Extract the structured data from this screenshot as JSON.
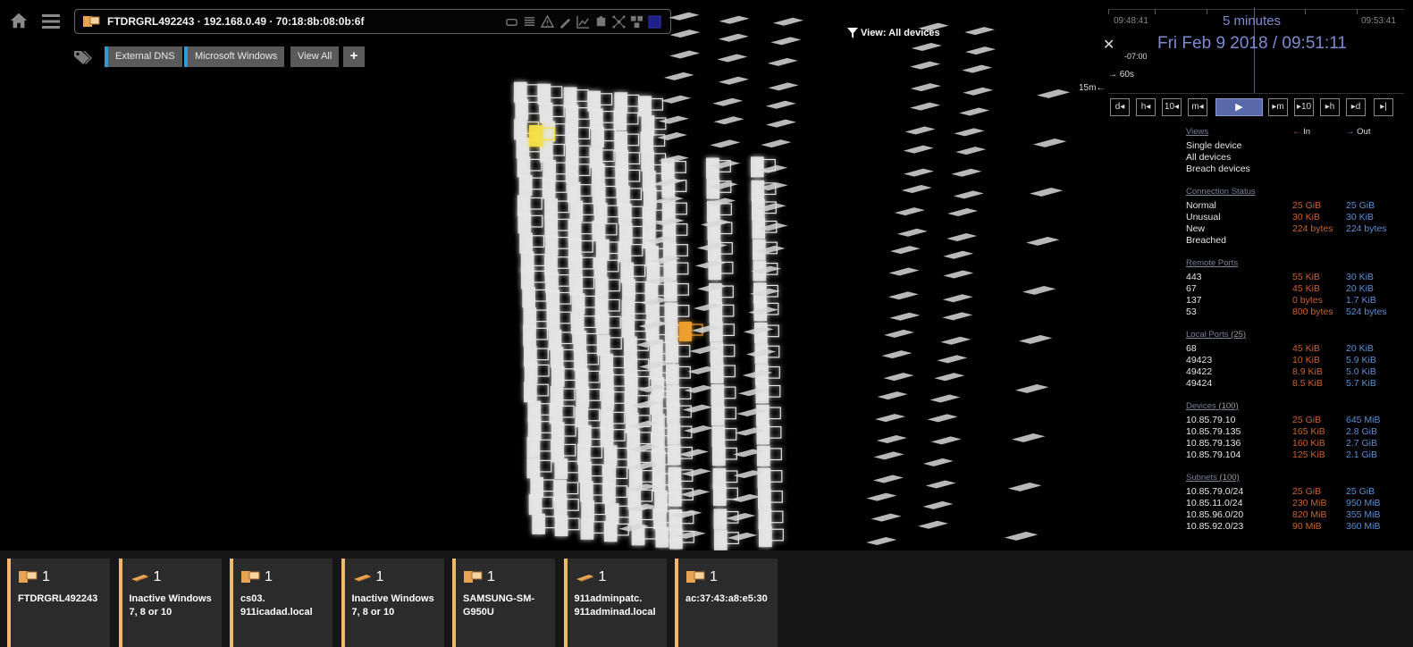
{
  "device": {
    "title": "FTDRGRL492243 · 192.168.0.49 · 70:18:8b:08:0b:6f",
    "tags": [
      "External DNS",
      "Microsoft Windows",
      "View All"
    ],
    "add_tag": "+"
  },
  "view": {
    "label": "View: All devices"
  },
  "timeline": {
    "start": "09:48:41",
    "end": "09:53:41",
    "duration": "5 minutes",
    "datetime": "Fri Feb 9 2018 / 09:51:11",
    "close": "✕",
    "offset": "-07:00",
    "step_label": "60s",
    "range_label": "15m",
    "buttons_back": [
      "d",
      "h",
      "10",
      "m"
    ],
    "buttons_fwd": [
      "m",
      "10",
      "h",
      "d"
    ]
  },
  "stats": {
    "views": {
      "title": "Views",
      "items": [
        "Single device",
        "All devices",
        "Breach devices"
      ],
      "in_label": "In",
      "out_label": "Out"
    },
    "connection_status": {
      "title": "Connection Status",
      "rows": [
        {
          "k": "Normal",
          "in": "25 GiB",
          "out": "25 GiB"
        },
        {
          "k": "Unusual",
          "in": "30 KiB",
          "out": "30 KiB"
        },
        {
          "k": "New",
          "in": "224 bytes",
          "out": "224 bytes"
        },
        {
          "k": "Breached",
          "in": "",
          "out": ""
        }
      ]
    },
    "remote_ports": {
      "title": "Remote Ports",
      "rows": [
        {
          "k": "443",
          "in": "55 KiB",
          "out": "30 KiB"
        },
        {
          "k": "67",
          "in": "45 KiB",
          "out": "20 KiB"
        },
        {
          "k": "137",
          "in": "0 bytes",
          "out": "1.7 KiB"
        },
        {
          "k": "53",
          "in": "800 bytes",
          "out": "524 bytes"
        }
      ]
    },
    "local_ports": {
      "title": "Local Ports",
      "count": "(25)",
      "rows": [
        {
          "k": "68",
          "in": "45 KiB",
          "out": "20 KiB"
        },
        {
          "k": "49423",
          "in": "10 KiB",
          "out": "5.9 KiB"
        },
        {
          "k": "49422",
          "in": "8.9 KiB",
          "out": "5.0 KiB"
        },
        {
          "k": "49424",
          "in": "8.5 KiB",
          "out": "5.7 KiB"
        }
      ]
    },
    "devices": {
      "title": "Devices",
      "count": "(100)",
      "rows": [
        {
          "k": "10.85.79.10",
          "in": "25 GiB",
          "out": "645 MiB"
        },
        {
          "k": "10.85.79.135",
          "in": "165 KiB",
          "out": "2.8 GiB"
        },
        {
          "k": "10.85.79.136",
          "in": "160 KiB",
          "out": "2.7 GiB"
        },
        {
          "k": "10.85.79.104",
          "in": "125 KiB",
          "out": "2.1 GiB"
        }
      ]
    },
    "subnets": {
      "title": "Subnets",
      "count": "(100)",
      "rows": [
        {
          "k": "10.85.79.0/24",
          "in": "25 GiB",
          "out": "25 GiB"
        },
        {
          "k": "10.85.11.0/24",
          "in": "230 MiB",
          "out": "950 MiB"
        },
        {
          "k": "10.85.96.0/20",
          "in": "820 MiB",
          "out": "355 MiB"
        },
        {
          "k": "10.85.92.0/23",
          "in": "90 MiB",
          "out": "360 MiB"
        }
      ]
    }
  },
  "cards": [
    {
      "count": "1",
      "name": "FTDRGRL492243",
      "icon": "desktop-icon"
    },
    {
      "count": "1",
      "name": "Inactive Windows 7, 8 or 10",
      "icon": "laptop-icon"
    },
    {
      "count": "1",
      "name": "cs03. 911icadad.local",
      "icon": "desktop-icon"
    },
    {
      "count": "1",
      "name": "Inactive Windows 7, 8 or 10",
      "icon": "laptop-icon"
    },
    {
      "count": "1",
      "name": "SAMSUNG-SM-G950U",
      "icon": "desktop-icon"
    },
    {
      "count": "1",
      "name": "911adminpatc. 911adminad.local",
      "icon": "laptop-icon"
    },
    {
      "count": "1",
      "name": "ac:37:43:a8:e5:30",
      "icon": "desktop-icon"
    }
  ],
  "colors": {
    "accent_orange": "#f0b86a",
    "in": "#c8642f",
    "out": "#5a8fd3",
    "timeline": "#7f8bd0",
    "tag_accent": "#2f9bd6"
  }
}
